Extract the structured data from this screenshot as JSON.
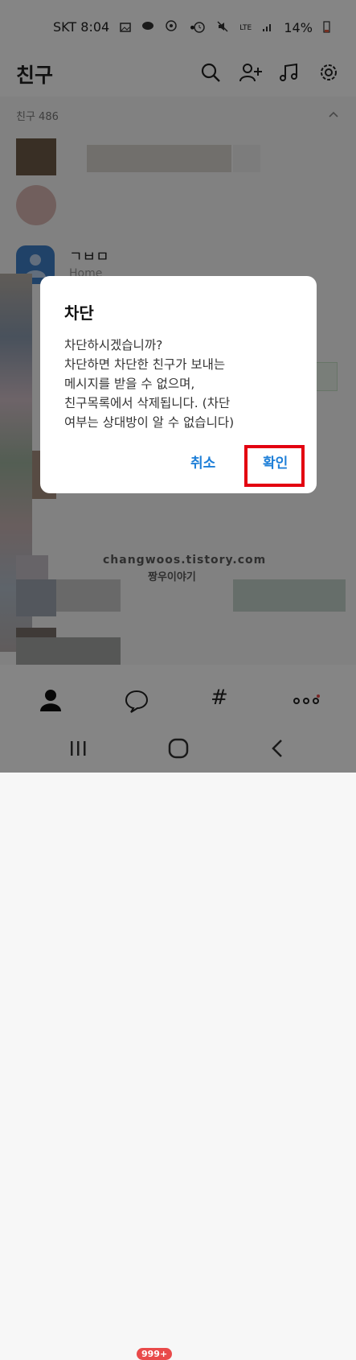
{
  "status_bar": {
    "carrier_time": "SKT 8:04",
    "dot": "•",
    "network": "LTE",
    "battery": "14%"
  },
  "header": {
    "title": "친구"
  },
  "section": {
    "label": "친구 486"
  },
  "list": {
    "visible_name": "ㄱㅂㅁ",
    "visible_status": "Home"
  },
  "dialog": {
    "title": "차단",
    "body": "차단하시겠습니까?\n차단하면 차단한 친구가 보내는\n메시지를 받을 수 없으며,\n친구목록에서 삭제됩니다. (차단\n여부는 상대방이 알 수 없습니다)",
    "cancel_label": "취소",
    "confirm_label": "확인"
  },
  "watermark": {
    "line1": "changwoos.tistory.com",
    "line2": "짱우이야기"
  },
  "bottom_nav": {
    "chat_badge": "999+",
    "hash_label": "#"
  },
  "colors": {
    "accent_button": "#1e7fd8",
    "highlight_box": "#e30010",
    "badge": "#e94a4a"
  }
}
